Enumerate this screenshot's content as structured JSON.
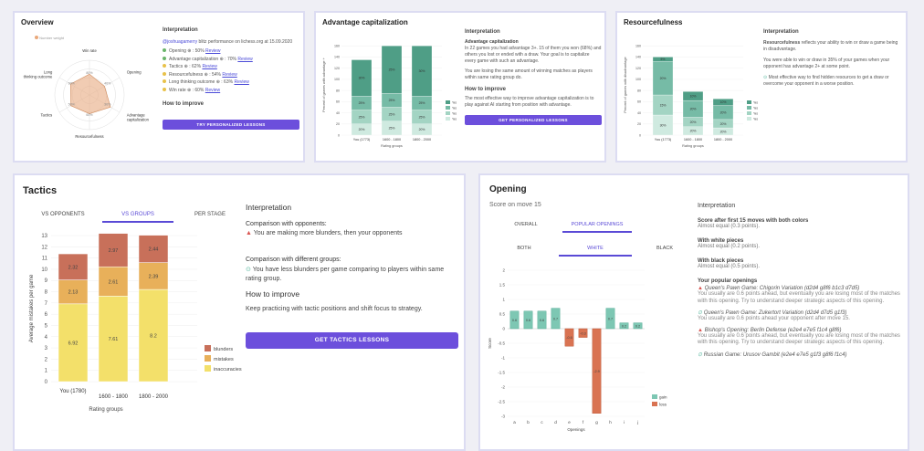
{
  "overview": {
    "title": "Overview",
    "legend": "Number weight",
    "axes": [
      "Win rate",
      "Opening",
      "Advantage capitalization",
      "Resourcefulness",
      "Tactics",
      "Long thinking outcome"
    ],
    "ticks": [
      "80%",
      "40%",
      "30%",
      "60%",
      "50%",
      "60%"
    ],
    "interp_title": "Interpretation",
    "intro_user": "@joshuagamerry",
    "intro_text": " blitz performance on lichess.org at 15.09.2020",
    "items": [
      {
        "text": "Opening ⊕ : 50%",
        "color": "#6ab56a",
        "link": "Review"
      },
      {
        "text": "Advantage capitalization ⊕ : 70%",
        "color": "#6ab56a",
        "link": "Review"
      },
      {
        "text": "Tactics ⊕ : 62%",
        "color": "#e8c24a",
        "link": "Review"
      },
      {
        "text": "Resourcefulness ⊕ : 54%",
        "color": "#e8c24a",
        "link": "Review"
      },
      {
        "text": "Long thinking outcome ⊕ : 63%",
        "color": "#e8c24a",
        "link": "Review"
      },
      {
        "text": "Win rate ⊕ : 60%",
        "color": "#e8c24a",
        "link": "Review"
      }
    ],
    "improve_title": "How to improve",
    "button": "TRY PERSONALIZED LESSONS"
  },
  "advantage": {
    "title": "Advantage capitalization",
    "ylabel": "Percent of games with advantage +",
    "xlabel": "Rating groups",
    "interp_title": "Interpretation",
    "sub1": "Advantage capitalization",
    "p1": "In 22 games you had advantage 3+. 15 of them you won (68%) and others you lost or ended with a draw. Your goal is to capitalize every game with such an advantage.",
    "p2": "You are losing the same amount of winning matches as players within same rating group do.",
    "improve_title": "How to improve",
    "p3": "The most effective way to improve advantage capitalization is to play against AI starting from position with advantage.",
    "button": "GET PERSONALIZED LESSONS"
  },
  "resource": {
    "title": "Resourcefulness",
    "ylabel": "Percent of games with disadvantage",
    "xlabel": "Rating groups",
    "interp_title": "Interpretation",
    "p1a": "Resourcefulness",
    "p1b": " reflects your ability to win or draw a game being in disadvantage.",
    "p2": "You were able to win or draw in 35% of your games when your opponent has advantage 2+ at some point.",
    "p3": "Most effective way to find hidden resources to get a draw or overcome your opponent in a worse position."
  },
  "tactics": {
    "title": "Tactics",
    "tabs": [
      "VS OPPONENTS",
      "VS GROUPS",
      "PER STAGE"
    ],
    "ylabel": "Average mistakes per game",
    "xlabel": "Rating groups",
    "interp_title": "Interpretation",
    "c1": "Comparison with opponents:",
    "c1_text": "You are making more blunders, then your opponents",
    "c2": "Comparison with different groups:",
    "c2_text": "You have less blunders per game comparing to players within same rating group.",
    "improve_title": "How to improve",
    "improve_text": "Keep practicing with tactic positions and shift focus to strategy.",
    "button": "GET TACTICS LESSONS"
  },
  "opening": {
    "title": "Opening",
    "subtitle": "Score on move 15",
    "tabs1": [
      "OVERALL",
      "POPULAR OPENINGS"
    ],
    "tabs2": [
      "BOTH",
      "WHITE",
      "BLACK"
    ],
    "ylabel": "Score",
    "xlabel": "Openings",
    "interp_title": "Interpretation",
    "s1": "Score after first 15 moves with both colors",
    "s1v": "Almost equal (0.3 points).",
    "s2": "With white pieces",
    "s2v": "Almost equal (0.2 points).",
    "s3": "With black pieces",
    "s3v": "Almost equal (0.5 points).",
    "pop": "Your popular openings",
    "ops": [
      {
        "name": "Queen's Pawn Game: Chigorin Variation (d2d4 g8f6 b1c3 d7d5)",
        "good": false,
        "desc": "You usually are 0.6 points ahead, but eventually you are losing most of the matches with this opening. Try to understand deeper strategic aspects of this opening."
      },
      {
        "name": "Queen's Pawn Game: Zukertort Variation (d2d4 d7d5 g1f3)",
        "good": true,
        "desc": "You usually are 0.6 points ahead your opponent after move 15."
      },
      {
        "name": "Bishop's Opening: Berlin Defense (e2e4 e7e5 f1c4 g8f6)",
        "good": false,
        "desc": "You usually are 0.6 points ahead, but eventually you are losing most of the matches with this opening. Try to understand deeper strategic aspects of this opening."
      },
      {
        "name": "Russian Game: Urusov Gambit (e2e4 e7e5 g1f3 g8f6 f1c4)",
        "good": true,
        "desc": ""
      }
    ]
  },
  "chart_data": [
    {
      "type": "radar",
      "axes": [
        "Win rate",
        "Opening",
        "Advantage capitalization",
        "Resourcefulness",
        "Tactics",
        "Long thinking outcome"
      ],
      "values": [
        60,
        50,
        70,
        54,
        62,
        63
      ],
      "ylim": [
        0,
        100
      ]
    },
    {
      "type": "bar",
      "stacked": true,
      "categories": [
        "You (1773)",
        "1600 - 1800",
        "1800 - 2000"
      ],
      "ylim": [
        0,
        180
      ],
      "yticks": [
        0,
        20,
        40,
        60,
        80,
        100,
        120,
        140,
        160
      ],
      "series": [
        {
          "name": "Yes 1+",
          "values": [
            20,
            25,
            20
          ]
        },
        {
          "name": "Yes 2+",
          "values": [
            25,
            25,
            25
          ]
        },
        {
          "name": "Yes 3+",
          "values": [
            25,
            25,
            25
          ]
        },
        {
          "name": "Yes 4+",
          "values": [
            65,
            85,
            90
          ]
        }
      ],
      "labels": [
        [
          "20%",
          "25%",
          "25%",
          "30%"
        ],
        [
          "25%",
          "25%",
          "25%",
          "25%"
        ],
        [
          "20%",
          "25%",
          "25%",
          "30%"
        ]
      ]
    },
    {
      "type": "bar",
      "stacked": true,
      "categories": [
        "You (1773)",
        "1600 - 1800",
        "1800 - 2000"
      ],
      "ylim": [
        0,
        180
      ],
      "yticks": [
        0,
        20,
        40,
        60,
        80,
        100,
        120,
        140,
        160
      ],
      "series": [
        {
          "name": "Yes -1",
          "values": [
            36,
            15,
            13
          ]
        },
        {
          "name": "Yes -2",
          "values": [
            36,
            17,
            15
          ]
        },
        {
          "name": "Yes -3",
          "values": [
            60,
            30,
            25
          ]
        },
        {
          "name": "Yes -4",
          "values": [
            8,
            16,
            12
          ]
        }
      ],
      "labels": [
        [
          "30%",
          "15%",
          "20%",
          "5%"
        ],
        [
          "20%",
          "20%",
          "20%",
          "10%"
        ],
        [
          "20%",
          "20%",
          "20%",
          "10%"
        ]
      ]
    },
    {
      "type": "bar",
      "stacked": true,
      "categories": [
        "You (1780)",
        "1600 - 1800",
        "1800 - 2000"
      ],
      "ylim": [
        0,
        13
      ],
      "yticks": [
        0,
        1,
        2,
        3,
        4,
        5,
        6,
        7,
        8,
        9,
        10,
        11,
        12,
        13
      ],
      "series": [
        {
          "name": "inaccuracies",
          "values": [
            6.92,
            7.61,
            8.2
          ]
        },
        {
          "name": "mistakes",
          "values": [
            2.13,
            2.61,
            2.39
          ]
        },
        {
          "name": "blunders",
          "values": [
            2.32,
            2.97,
            2.44
          ]
        }
      ]
    },
    {
      "type": "bar",
      "categories": [
        "a",
        "b",
        "c",
        "d",
        "e",
        "f",
        "g",
        "h",
        "i",
        "j"
      ],
      "values": [
        0.6,
        0.6,
        0.6,
        0.7,
        -0.6,
        -0.3,
        -2.9,
        0.7,
        0.2,
        0.2
      ],
      "ylim": [
        -3,
        2
      ],
      "yticks": [
        2,
        1.5,
        1,
        0.5,
        0,
        -0.5,
        -1,
        -1.5,
        -2,
        -2.5,
        -3
      ],
      "series": [
        {
          "name": "gain"
        },
        {
          "name": "loss"
        }
      ]
    }
  ],
  "colors": {
    "accent": "#6c4fdc",
    "tab": "#5a4ad6",
    "blunder": "#c8705a",
    "mistake": "#e8b05a",
    "inaccuracy": "#f3e06a",
    "gain": "#7dc7b3",
    "loss": "#d97352",
    "teal": [
      "#cfeae0",
      "#a3d4c3",
      "#76bba6",
      "#4f9e86"
    ]
  }
}
